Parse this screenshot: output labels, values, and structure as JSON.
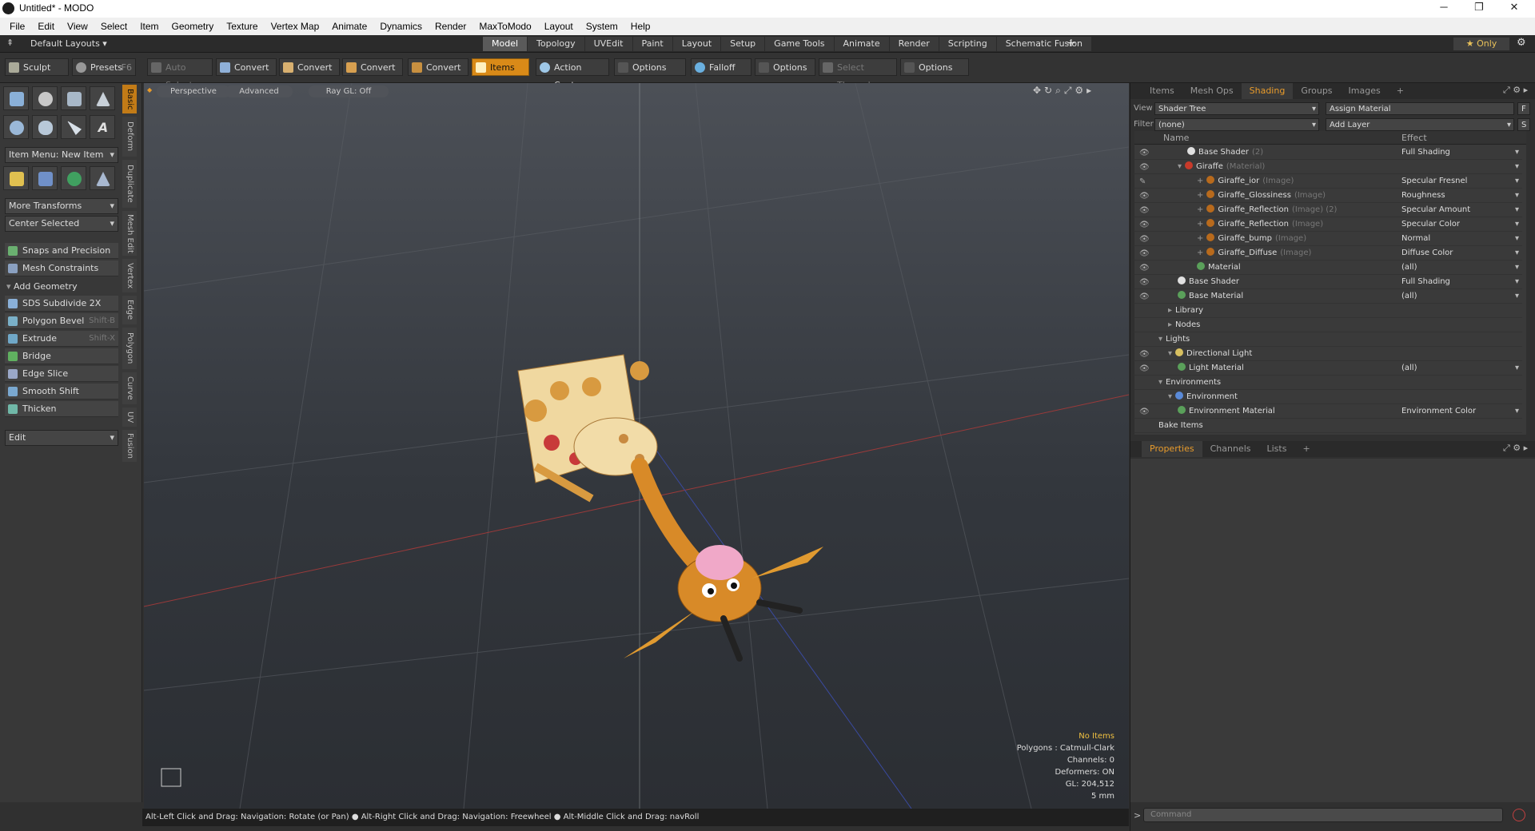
{
  "window": {
    "title": "Untitled* - MODO",
    "minimize": "─",
    "restore": "❐",
    "close": "✕"
  },
  "menu": [
    "File",
    "Edit",
    "View",
    "Select",
    "Item",
    "Geometry",
    "Texture",
    "Vertex Map",
    "Animate",
    "Dynamics",
    "Render",
    "MaxToModo",
    "Layout",
    "System",
    "Help"
  ],
  "layout_bar": {
    "layouts_label": "Default Layouts ▾",
    "tabs": [
      "Model",
      "Topology",
      "UVEdit",
      "Paint",
      "Layout",
      "Setup",
      "Game Tools",
      "Animate",
      "Render",
      "Scripting",
      "Schematic Fusion"
    ],
    "active_tab": "Model",
    "add": "+",
    "only_label": "★  Only"
  },
  "toolbar": {
    "sculpt": "Sculpt",
    "presets": "Presets",
    "presets_key": "F6",
    "auto_select": "Auto Select",
    "convert": "Convert",
    "items": "Items",
    "action_center": "Action Center",
    "options": "Options",
    "falloff": "Falloff",
    "select_through": "Select Through"
  },
  "left_panel": {
    "item_menu": "Item Menu: New Item",
    "more_transforms": "More Transforms",
    "center_selected": "Center Selected",
    "snaps": "Snaps and Precision",
    "mesh_constraints": "Mesh Constraints",
    "add_geometry": "Add Geometry",
    "tools": [
      {
        "label": "SDS Subdivide 2X",
        "shortcut": ""
      },
      {
        "label": "Polygon Bevel",
        "shortcut": "Shift-B"
      },
      {
        "label": "Extrude",
        "shortcut": "Shift-X"
      },
      {
        "label": "Bridge",
        "shortcut": ""
      },
      {
        "label": "Edge Slice",
        "shortcut": ""
      },
      {
        "label": "Smooth Shift",
        "shortcut": ""
      },
      {
        "label": "Thicken",
        "shortcut": ""
      }
    ],
    "edit_dropdown": "Edit"
  },
  "side_tabs": [
    "Basic",
    "Deform",
    "Duplicate",
    "Mesh Edit",
    "Vertex",
    "Edge",
    "Polygon",
    "Curve",
    "UV",
    "Fusion"
  ],
  "viewport": {
    "perspective": "Perspective",
    "advanced": "Advanced",
    "raygl": "Ray GL: Off",
    "info": {
      "no_items": "No Items",
      "polygons": "Polygons : Catmull-Clark",
      "channels": "Channels: 0",
      "deformers": "Deformers: ON",
      "gl": "GL: 204,512",
      "scale": "5 mm"
    }
  },
  "status_bar": "Alt-Left Click and Drag: Navigation: Rotate (or Pan) ● Alt-Right Click and Drag: Navigation: Freewheel ● Alt-Middle Click and Drag: navRoll",
  "right_panel": {
    "top_tabs": [
      "Items",
      "Mesh Ops",
      "Shading",
      "Groups",
      "Images",
      "+"
    ],
    "active_top": "Shading",
    "view_label": "View",
    "view_value": "Shader Tree",
    "assign_material": "Assign Material",
    "filter_label": "Filter",
    "filter_value": "(none)",
    "add_layer": "Add Layer",
    "f_btn": "F",
    "s_btn": "S",
    "col_name": "Name",
    "col_effect": "Effect",
    "rows": [
      {
        "name": "Base Shader",
        "type": "(2)",
        "effect": "Full Shading",
        "indent": 3,
        "eye": "👁",
        "ball": "#e0e0e0",
        "dd": true
      },
      {
        "name": "Giraffe",
        "type": "(Material)",
        "effect": "",
        "indent": 2,
        "eye": "👁",
        "ball": "#c83a2a",
        "dd": true,
        "exp": "▾"
      },
      {
        "name": "Giraffe_ior",
        "type": "(Image)",
        "effect": "Specular Fresnel",
        "indent": 4,
        "eye": "✎",
        "ball": "#b86a1c",
        "dd": true,
        "exp": "+"
      },
      {
        "name": "Giraffe_Glossiness",
        "type": "(Image)",
        "effect": "Roughness",
        "indent": 4,
        "eye": "👁",
        "ball": "#b86a1c",
        "dd": true,
        "exp": "+"
      },
      {
        "name": "Giraffe_Reflection",
        "type": "(Image) (2)",
        "effect": "Specular Amount",
        "indent": 4,
        "eye": "👁",
        "ball": "#b86a1c",
        "dd": true,
        "exp": "+"
      },
      {
        "name": "Giraffe_Reflection",
        "type": "(Image)",
        "effect": "Specular Color",
        "indent": 4,
        "eye": "👁",
        "ball": "#b86a1c",
        "dd": true,
        "exp": "+"
      },
      {
        "name": "Giraffe_bump",
        "type": "(Image)",
        "effect": "Normal",
        "indent": 4,
        "eye": "👁",
        "ball": "#b86a1c",
        "dd": true,
        "exp": "+"
      },
      {
        "name": "Giraffe_Diffuse",
        "type": "(Image)",
        "effect": "Diffuse Color",
        "indent": 4,
        "eye": "👁",
        "ball": "#b86a1c",
        "dd": true,
        "exp": "+"
      },
      {
        "name": "Material",
        "type": "",
        "effect": "(all)",
        "indent": 4,
        "eye": "👁",
        "ball": "#5aa05a",
        "dd": true
      },
      {
        "name": "Base Shader",
        "type": "",
        "effect": "Full Shading",
        "indent": 2,
        "eye": "👁",
        "ball": "#e0e0e0",
        "dd": true
      },
      {
        "name": "Base Material",
        "type": "",
        "effect": "(all)",
        "indent": 2,
        "eye": "👁",
        "ball": "#5aa05a",
        "dd": true
      },
      {
        "name": "Library",
        "type": "",
        "effect": "",
        "indent": 1,
        "eye": "",
        "ball": "",
        "exp": "▸"
      },
      {
        "name": "Nodes",
        "type": "",
        "effect": "",
        "indent": 1,
        "eye": "",
        "ball": "",
        "exp": "▸"
      },
      {
        "name": "Lights",
        "type": "",
        "effect": "",
        "indent": 0,
        "eye": "",
        "ball": "",
        "exp": "▾"
      },
      {
        "name": "Directional Light",
        "type": "",
        "effect": "",
        "indent": 1,
        "eye": "👁",
        "ball": "#d8c060",
        "exp": "▾"
      },
      {
        "name": "Light Material",
        "type": "",
        "effect": "(all)",
        "indent": 2,
        "eye": "👁",
        "ball": "#5aa05a",
        "dd": true
      },
      {
        "name": "Environments",
        "type": "",
        "effect": "",
        "indent": 0,
        "eye": "",
        "ball": "",
        "exp": "▾"
      },
      {
        "name": "Environment",
        "type": "",
        "effect": "",
        "indent": 1,
        "eye": "",
        "ball": "#5a8ad8",
        "exp": "▾"
      },
      {
        "name": "Environment Material",
        "type": "",
        "effect": "Environment Color",
        "indent": 2,
        "eye": "👁",
        "ball": "#5aa05a",
        "dd": true
      },
      {
        "name": "Bake Items",
        "type": "",
        "effect": "",
        "indent": 0,
        "eye": "",
        "ball": ""
      }
    ],
    "bottom_tabs": [
      "Properties",
      "Channels",
      "Lists",
      "+"
    ],
    "active_bottom": "Properties",
    "command_placeholder": "Command"
  },
  "colors": {
    "accent": "#d98a18",
    "viewport_top": "#4c5057",
    "viewport_bottom": "#2b2e33"
  }
}
